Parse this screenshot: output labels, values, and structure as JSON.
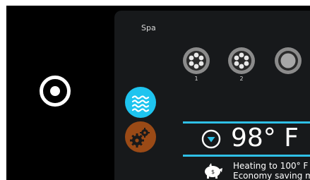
{
  "panel": {
    "title": "Spa",
    "pumps": [
      {
        "icon": "fan-pump-icon",
        "number": "1"
      },
      {
        "icon": "fan-pump-icon",
        "number": "2"
      },
      {
        "icon": "circulation-pump-icon",
        "number": ""
      }
    ],
    "side_buttons": [
      {
        "icon": "water-waves-icon",
        "color": "#1ec4ef"
      },
      {
        "icon": "gears-icon",
        "color": "#9a4a16"
      }
    ],
    "temperature": {
      "value": "98° F",
      "arrow_icon": "down-arrow-icon"
    },
    "status": {
      "icon": "piggy-bank-icon",
      "line1": "Heating to 100° F",
      "line2": "Economy saving mod"
    }
  },
  "colors": {
    "accent": "#2fbfe6",
    "background": "#000000",
    "panel": "#17191b",
    "text": "#ffffff"
  }
}
